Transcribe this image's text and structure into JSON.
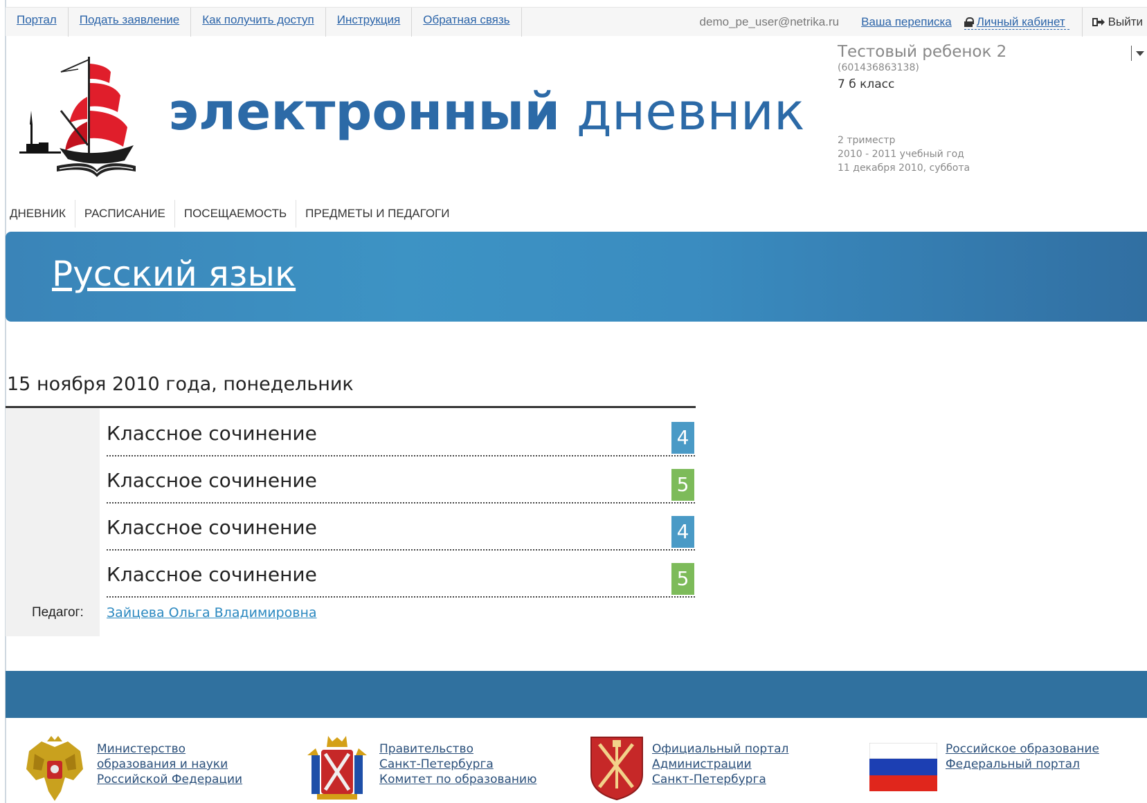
{
  "topbar": {
    "links": [
      "Портал",
      "Подать заявление",
      "Как получить доступ",
      "Инструкция",
      "Обратная связь"
    ],
    "user_email": "demo_pe_user@netrika.ru",
    "messages_link": "Ваша переписка",
    "cabinet_link": "Личный кабинет",
    "logout_label": "Выйти"
  },
  "header": {
    "brand_bold": "электронный",
    "brand_light": "дневник",
    "child_name": "Тестовый ребенок 2",
    "child_id": "(601436863138)",
    "child_class": "7 б класс",
    "term": "2 триместр",
    "school_year": "2010 - 2011 учебный год",
    "current_date": "11 декабря 2010, суббота"
  },
  "mainnav": {
    "items": [
      "ДНЕВНИК",
      "РАСПИСАНИЕ",
      "ПОСЕЩАЕМОСТЬ",
      "ПРЕДМЕТЫ И ПЕДАГОГИ"
    ]
  },
  "subject": {
    "title": "Русский язык"
  },
  "day": {
    "heading": "15 ноября 2010 года, понедельник",
    "grades": [
      {
        "work": "Классное сочинение",
        "mark": "4",
        "color": "#4a9ac6"
      },
      {
        "work": "Классное сочинение",
        "mark": "5",
        "color": "#7dbb5a"
      },
      {
        "work": "Классное сочинение",
        "mark": "4",
        "color": "#4a9ac6"
      },
      {
        "work": "Классное сочинение",
        "mark": "5",
        "color": "#7dbb5a"
      }
    ],
    "teacher_label": "Педагог:",
    "teacher_name": "Зайцева Ольга Владимировна"
  },
  "footer": {
    "partners": [
      {
        "icon": "russian-coat-of-arms-icon",
        "lines": [
          "Министерство",
          "образования и науки",
          "Российской Федерации"
        ]
      },
      {
        "icon": "spb-coat-of-arms-icon",
        "lines": [
          "Правительство",
          "Санкт-Петербурга",
          "Комитет по образованию"
        ]
      },
      {
        "icon": "spb-shield-icon",
        "lines": [
          "Официальный портал",
          "Администрации",
          "Санкт-Петербурга"
        ]
      },
      {
        "icon": "russian-flag-icon",
        "lines": [
          "Российское образование",
          "Федеральный портал"
        ]
      }
    ]
  },
  "colors": {
    "accent": "#2c6aa7",
    "banner": "#3a8cc0",
    "footer_band": "#30719f",
    "mark_4": "#4a9ac6",
    "mark_5": "#7dbb5a"
  }
}
